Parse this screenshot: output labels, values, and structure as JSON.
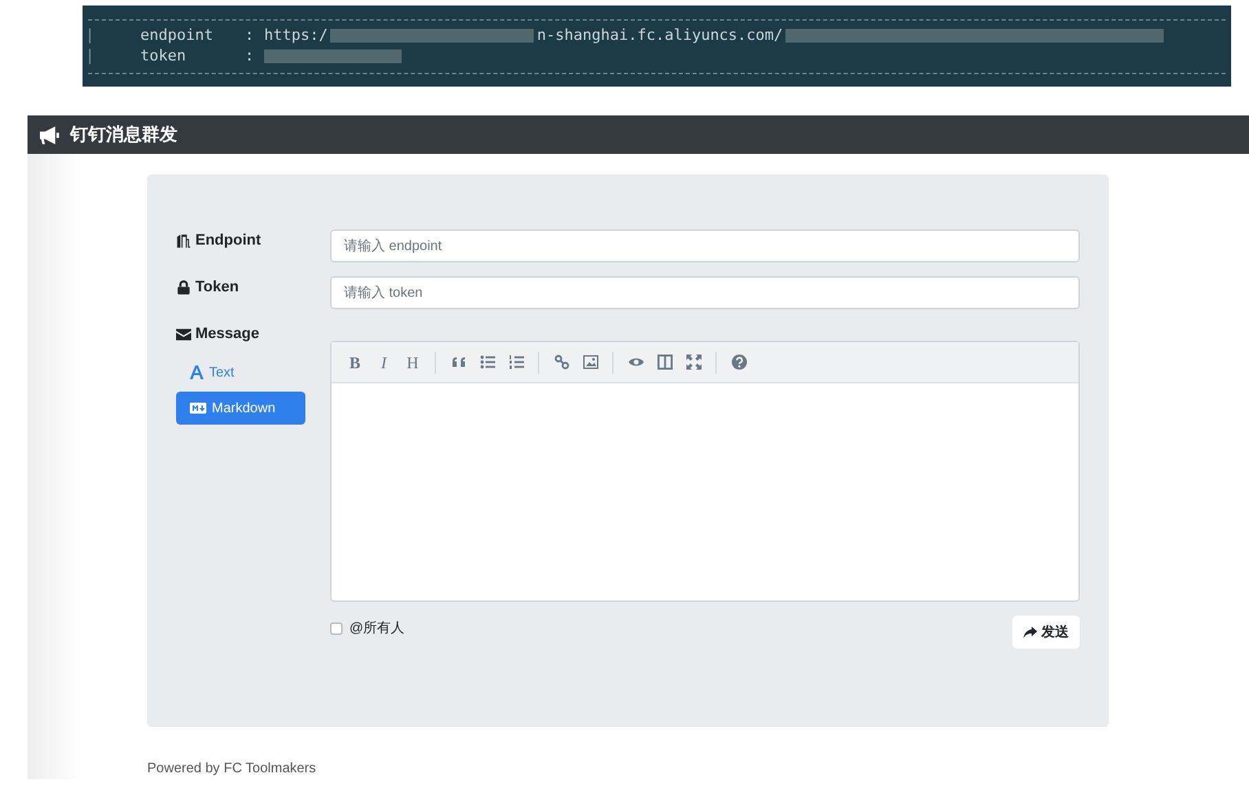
{
  "terminal": {
    "lines": [
      {
        "border": "|",
        "label": "endpoint",
        "separator": ":",
        "value_start": "https:/",
        "value_mid": "n-shanghai.fc.aliyuncs.com/"
      },
      {
        "border": "|",
        "label": "token",
        "separator": ":"
      }
    ]
  },
  "header": {
    "title": "钉钉消息群发"
  },
  "form": {
    "fields": [
      {
        "kind": "endpoint",
        "label": "Endpoint",
        "placeholder": "请输入 endpoint"
      },
      {
        "kind": "token",
        "label": "Token",
        "placeholder": "请输入 token"
      }
    ],
    "message": {
      "label": "Message",
      "tabs": [
        {
          "kind": "text",
          "label": "Text",
          "selected": false
        },
        {
          "kind": "markdown",
          "label": "Markdown",
          "selected": true
        }
      ],
      "toolbar": [
        {
          "kind": "bold",
          "label": "B"
        },
        {
          "kind": "italic",
          "label": "I"
        },
        {
          "kind": "heading",
          "label": "H"
        },
        {
          "kind": "separator"
        },
        {
          "kind": "quote"
        },
        {
          "kind": "unordered-list"
        },
        {
          "kind": "ordered-list"
        },
        {
          "kind": "separator"
        },
        {
          "kind": "link"
        },
        {
          "kind": "image"
        },
        {
          "kind": "separator"
        },
        {
          "kind": "preview"
        },
        {
          "kind": "side-by-side"
        },
        {
          "kind": "fullscreen"
        },
        {
          "kind": "separator"
        },
        {
          "kind": "help"
        }
      ]
    },
    "mention_all": {
      "label": "@所有人",
      "checked": false
    },
    "send_button": {
      "label": "发送"
    }
  },
  "footer": {
    "text": "Powered by FC Toolmakers"
  }
}
